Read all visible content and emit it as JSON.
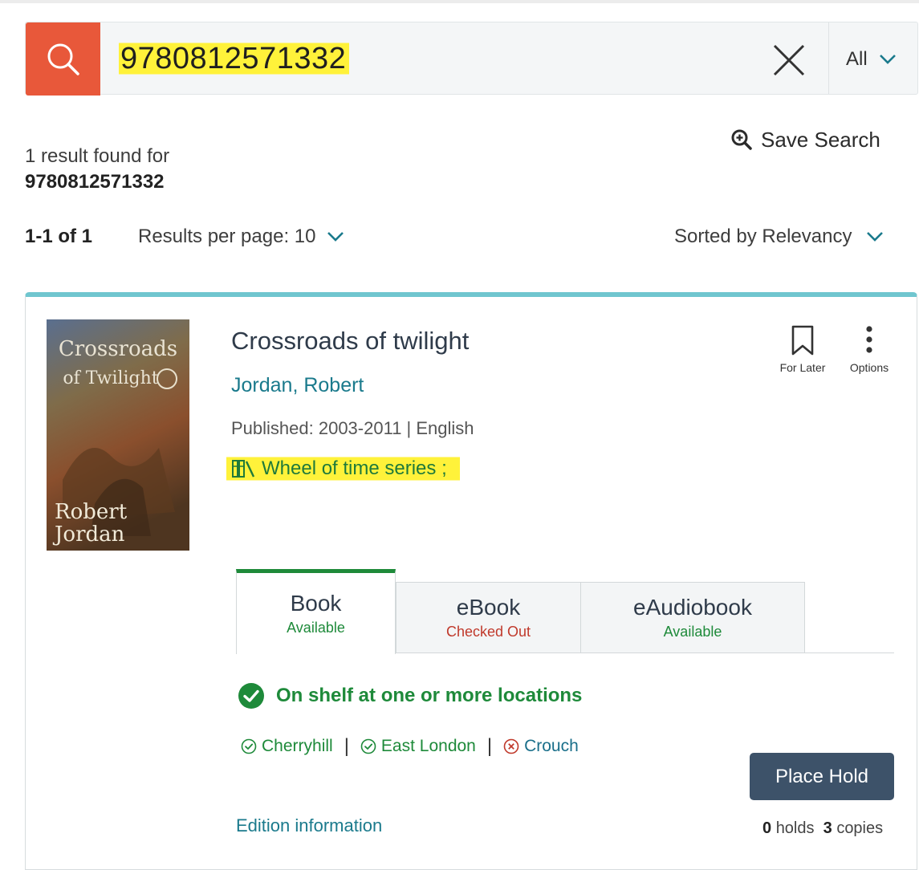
{
  "search": {
    "query": "9780812571332",
    "scope": "All",
    "colors": {
      "search_button": "#e8583a",
      "highlight": "#fff23a"
    }
  },
  "results": {
    "save_search_label": "Save Search",
    "count_text": "1 result found for",
    "query_echo": "9780812571332",
    "range": "1-1 of 1",
    "per_page": "Results per page: 10",
    "sort": "Sorted by Relevancy"
  },
  "item": {
    "cover_icon": "book-cover-image",
    "cover_text": {
      "title_line1": "Crossroads",
      "title_line2": "of Twilight",
      "author_line1": "Robert",
      "author_line2": "Jordan"
    },
    "title": "Crossroads of twilight",
    "author": "Jordan, Robert",
    "published": "Published: 2003-2011 | English",
    "series": "Wheel of time series ;",
    "for_later_label": "For Later",
    "options_label": "Options",
    "formats": [
      {
        "name": "Book",
        "status": "Available",
        "status_color": "#1e8a3a"
      },
      {
        "name": "eBook",
        "status": "Checked Out",
        "status_color": "#c0392b"
      },
      {
        "name": "eAudiobook",
        "status": "Available",
        "status_color": "#1e8a3a"
      }
    ],
    "availability": "On shelf at one or more locations",
    "locations": [
      {
        "name": "Cherryhill",
        "available": true
      },
      {
        "name": "East London",
        "available": true
      },
      {
        "name": "Crouch",
        "available": false
      }
    ],
    "place_hold_label": "Place Hold",
    "edition_link": "Edition information",
    "holds_count": "0",
    "holds_label": "holds",
    "copies_count": "3",
    "copies_label": "copies"
  }
}
